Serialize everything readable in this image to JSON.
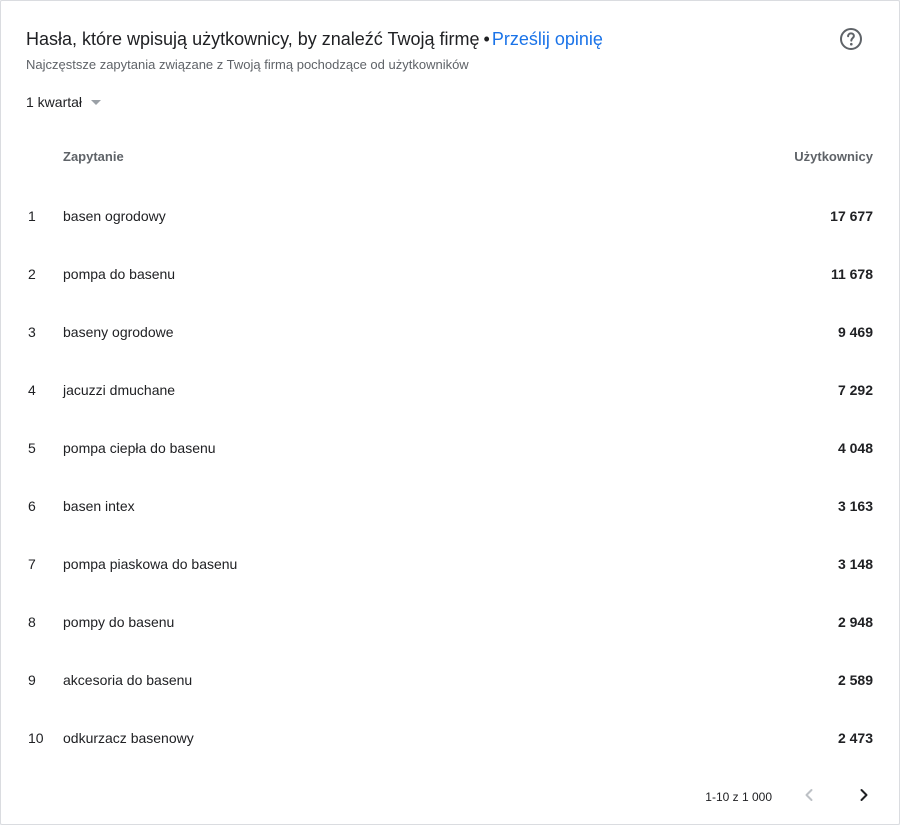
{
  "header": {
    "title": "Hasła, które wpisują użytkownicy, by znaleźć Twoją firmę",
    "separator": "•",
    "feedback_link": "Prześlij opinię",
    "subtitle": "Najczęstsze zapytania związane z Twoją firmą pochodzące od użytkowników",
    "help_icon": "help-circle-icon"
  },
  "period": {
    "selected": "1 kwartał",
    "icon": "dropdown-caret-icon"
  },
  "table": {
    "columns": {
      "query": "Zapytanie",
      "users": "Użytkownicy"
    },
    "rows": [
      {
        "rank": "1",
        "query": "basen ogrodowy",
        "users": "17 677"
      },
      {
        "rank": "2",
        "query": "pompa do basenu",
        "users": "11 678"
      },
      {
        "rank": "3",
        "query": "baseny ogrodowe",
        "users": "9 469"
      },
      {
        "rank": "4",
        "query": "jacuzzi dmuchane",
        "users": "7 292"
      },
      {
        "rank": "5",
        "query": "pompa ciepła do basenu",
        "users": "4 048"
      },
      {
        "rank": "6",
        "query": "basen intex",
        "users": "3 163"
      },
      {
        "rank": "7",
        "query": "pompa piaskowa do basenu",
        "users": "3 148"
      },
      {
        "rank": "8",
        "query": "pompy do basenu",
        "users": "2 948"
      },
      {
        "rank": "9",
        "query": "akcesoria do basenu",
        "users": "2 589"
      },
      {
        "rank": "10",
        "query": "odkurzacz basenowy",
        "users": "2 473"
      }
    ]
  },
  "pagination": {
    "range": "1-10 z 1 000",
    "prev_icon": "chevron-left-icon",
    "next_icon": "chevron-right-icon"
  },
  "colors": {
    "link": "#1a73e8",
    "text_primary": "#202124",
    "text_secondary": "#5f6368",
    "icon_disabled": "#bdc1c6",
    "border": "#dadce0"
  }
}
